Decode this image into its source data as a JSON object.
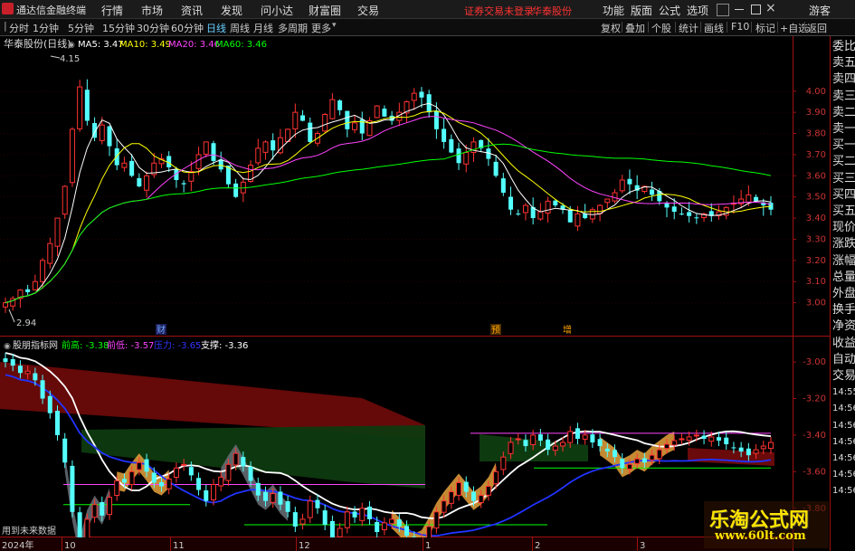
{
  "app": {
    "name": "通达信金融终端"
  },
  "menu": [
    "行情",
    "市场",
    "资讯",
    "发现",
    "问小达",
    "财富圈",
    "交易"
  ],
  "status_text": {
    "login": "证券交易未登录",
    "stock": "华泰股份"
  },
  "menu_right": [
    "功能",
    "版面",
    "公式",
    "选项"
  ],
  "user": "游客",
  "periods": [
    "分时",
    "1分钟",
    "5分钟",
    "15分钟",
    "30分钟",
    "60分钟",
    "日线",
    "周线",
    "月线",
    "多周期",
    "更多"
  ],
  "active_period": "日线",
  "tools": [
    "复权",
    "叠加",
    "个股",
    "统计",
    "画线",
    "F10",
    "标记",
    "+自选",
    "返回"
  ],
  "stock_title": "华泰股份(日线)",
  "ma": [
    {
      "label": "MA5: 3.47",
      "color": "#ffffff"
    },
    {
      "label": "MA10: 3.49",
      "color": "#ffff00"
    },
    {
      "label": "MA20: 3.46",
      "color": "#ff44ff"
    },
    {
      "label": "MA60: 3.46",
      "color": "#00ff00"
    }
  ],
  "price_high_label": "4.15",
  "price_low_label": "2.94",
  "events": [
    "财",
    "预",
    "增"
  ],
  "indicator": {
    "name": "股朋指标网",
    "values": [
      {
        "label": "前高: -3.38",
        "color": "#00ff00"
      },
      {
        "label": "前低: -3.57",
        "color": "#ff44ff"
      },
      {
        "label": "压力: -3.65",
        "color": "#3333ff"
      },
      {
        "label": "支撑: -3.36",
        "color": "#ffffff"
      }
    ]
  },
  "future_label": "用到未来数据",
  "dates": [
    "2024年",
    "10",
    "11",
    "12",
    "1",
    "2",
    "3"
  ],
  "right_panel": [
    "委比",
    "卖五",
    "卖四",
    "卖三",
    "卖二",
    "卖一",
    "买一",
    "买二",
    "买三",
    "买四",
    "买五",
    "现价",
    "涨跌",
    "涨幅",
    "总量",
    "外盘",
    "换手",
    "净资",
    "收益",
    "自动",
    "交易",
    "14:55",
    "14:56",
    "14:56",
    "14:56",
    "14:56",
    "14:56",
    "14:56"
  ],
  "watermark": {
    "title": "乐淘公式网",
    "url": "www.60lt.com"
  },
  "chart_data": [
    {
      "type": "candlestick",
      "title": "华泰股份(日线)",
      "y_ticks": [
        4.0,
        3.9,
        3.8,
        3.7,
        3.6,
        3.5,
        3.4,
        3.3,
        3.2,
        3.1,
        3.0
      ],
      "ylim": [
        2.9,
        4.2
      ],
      "annotations": [
        {
          "label": "4.15",
          "value": 4.15
        },
        {
          "label": "2.94",
          "value": 2.94
        }
      ],
      "close": [
        3.0,
        3.02,
        3.06,
        3.05,
        3.1,
        3.2,
        3.28,
        3.4,
        3.55,
        3.82,
        4.02,
        3.86,
        3.78,
        3.84,
        3.74,
        3.65,
        3.66,
        3.6,
        3.55,
        3.6,
        3.66,
        3.68,
        3.64,
        3.58,
        3.56,
        3.62,
        3.7,
        3.76,
        3.67,
        3.63,
        3.56,
        3.5,
        3.57,
        3.65,
        3.73,
        3.76,
        3.72,
        3.78,
        3.82,
        3.9,
        3.86,
        3.76,
        3.8,
        3.89,
        3.96,
        3.91,
        3.82,
        3.85,
        3.8,
        3.86,
        3.93,
        3.88,
        3.86,
        3.9,
        3.95,
        3.99,
        3.97,
        3.9,
        3.82,
        3.76,
        3.71,
        3.66,
        3.71,
        3.76,
        3.73,
        3.68,
        3.6,
        3.52,
        3.44,
        3.42,
        3.46,
        3.4,
        3.43,
        3.48,
        3.46,
        3.44,
        3.38,
        3.42,
        3.4,
        3.44,
        3.46,
        3.49,
        3.52,
        3.58,
        3.56,
        3.53,
        3.55,
        3.51,
        3.48,
        3.45,
        3.43,
        3.42,
        3.41,
        3.4,
        3.42,
        3.41,
        3.43,
        3.45,
        3.47,
        3.49,
        3.51,
        3.48,
        3.46,
        3.44
      ],
      "MA5": 3.47,
      "MA10": 3.49,
      "MA20": 3.46,
      "MA60": 3.46
    },
    {
      "type": "line",
      "title": "股朋指标网",
      "y_ticks": [
        -3.0,
        -3.2,
        -3.4,
        -3.6,
        -3.8
      ],
      "ylim": [
        -3.92,
        -2.95
      ],
      "series": [
        {
          "name": "前高",
          "color": "#00ff00",
          "last": -3.38
        },
        {
          "name": "前低",
          "color": "#ff44ff",
          "last": -3.57
        },
        {
          "name": "压力",
          "color": "#3333ff",
          "last": -3.65
        },
        {
          "name": "支撑",
          "color": "#ffffff",
          "last": -3.36
        }
      ]
    }
  ]
}
